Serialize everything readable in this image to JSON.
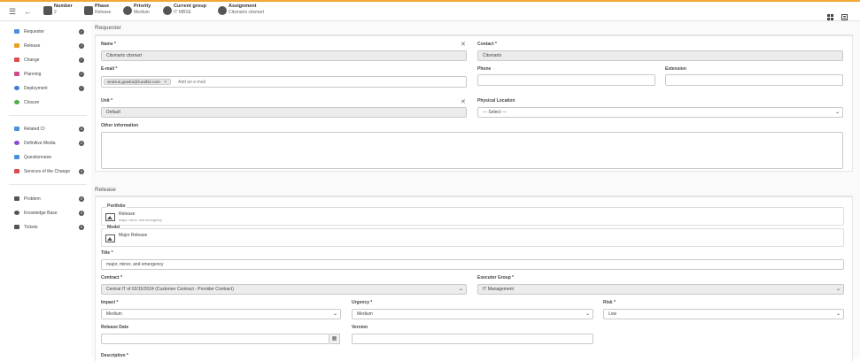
{
  "topbar": {
    "number": {
      "label": "Number",
      "value": "2"
    },
    "phase": {
      "label": "Phase",
      "value": "Release"
    },
    "priority": {
      "label": "Priority",
      "value": "Medium"
    },
    "group": {
      "label": "Current group",
      "value": "IT MBSE"
    },
    "assignment": {
      "label": "Assignment",
      "value": "Citsmartx citsmart"
    }
  },
  "sidebar": {
    "items": [
      {
        "label": "Requester",
        "color": "#4a8fe0"
      },
      {
        "label": "Release",
        "color": "#e8a020"
      },
      {
        "label": "Change",
        "color": "#e04a4a"
      },
      {
        "label": "Planning",
        "color": "#d04a8a"
      },
      {
        "label": "Deployment",
        "color": "#3a7fd0"
      },
      {
        "label": "Closure",
        "color": "#4ab04a"
      },
      {
        "label": "Related CI",
        "color": "#4a8fe0"
      },
      {
        "label": "Definitive Media",
        "color": "#8a4ad0"
      },
      {
        "label": "Questionnaire",
        "color": "#4a8fe0"
      },
      {
        "label": "Services of the Change",
        "color": "#e04a4a"
      },
      {
        "label": "Problem",
        "color": "#555555"
      },
      {
        "label": "Knowledge Base",
        "color": "#555555"
      },
      {
        "label": "Tickets",
        "color": "#555555"
      }
    ],
    "counts": [
      "0",
      "0",
      "0",
      "0",
      "0",
      "0"
    ]
  },
  "requester": {
    "title": "Requester",
    "name_label": "Name *",
    "name_value": "Citsmartx citsmart",
    "contact_label": "Contact *",
    "contact_value": "Citsmartx",
    "email_label": "E-mail *",
    "email_chip": "vinicius.gravito@run2biz.com",
    "email_placeholder": "Add an e-mail",
    "phone_label": "Phone",
    "extension_label": "Extension",
    "unit_label": "Unit *",
    "unit_value": "Default",
    "location_label": "Physical Location",
    "location_value": "--- Select ---",
    "other_label": "Other information"
  },
  "release": {
    "title": "Release",
    "portfolio_label": "Portfolio",
    "portfolio_value": "Release",
    "portfolio_sub": "major, minor, and emergency",
    "model_label": "Model",
    "model_value": "Major Release",
    "title_label": "Title *",
    "title_value": "major, minor, and emergency",
    "contract_label": "Contract *",
    "contract_value": "Central IT of 02/15/2024 (Customer Contract - Provider Contract)",
    "executor_label": "Executor Group *",
    "executor_value": "IT Management",
    "impact_label": "Impact *",
    "impact_value": "Medium",
    "urgency_label": "Urgency *",
    "urgency_value": "Medium",
    "risk_label": "Risk *",
    "risk_value": "Low",
    "release_date_label": "Release Date",
    "version_label": "Version",
    "description_label": "Description *"
  }
}
